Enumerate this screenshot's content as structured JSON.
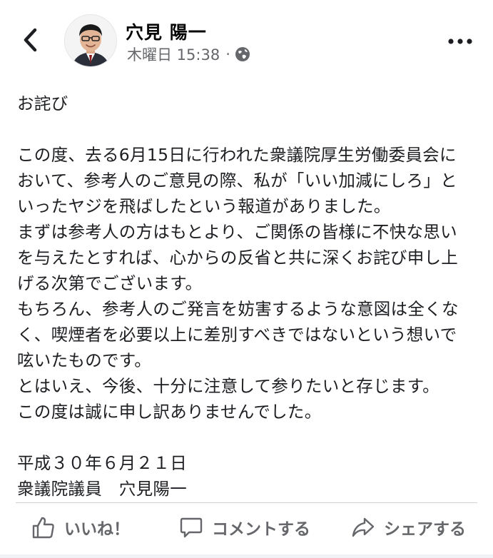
{
  "header": {
    "author_name": "穴見 陽一",
    "timestamp": "木曜日 15:38",
    "separator": "·",
    "privacy_icon": "globe-icon",
    "back_icon": "chevron-left-icon",
    "more_icon": "more-horizontal-icon"
  },
  "post": {
    "lines": [
      "お詫び",
      "",
      "この度、去る6月15日に行われた衆議院厚生労働委員会に",
      "おいて、参考人のご意見の際、私が「いい加減にしろ」と",
      "いったヤジを飛ばしたという報道がありました。",
      "まずは参考人の方はもとより、ご関係の皆様に不快な思い",
      "を与えたとすれば、心からの反省と共に深くお詫び申し上",
      "げる次第でございます。",
      "もちろん、参考人のご発言を妨害するような意図は全くな",
      "く、喫煙者を必要以上に差別すべきではないという想いで",
      "呟いたものです。",
      "とはいえ、今後、十分に注意して参りたいと存じます。",
      "この度は誠に申し訳ありませんでした。",
      "",
      "平成３０年６月２１日",
      "衆議院議員　穴見陽一"
    ]
  },
  "actions": {
    "like_label": "いいね！",
    "comment_label": "コメントする",
    "share_label": "シェアする"
  },
  "colors": {
    "text": "#1c1e21",
    "secondary": "#65676b",
    "divider": "#ced0d4"
  }
}
